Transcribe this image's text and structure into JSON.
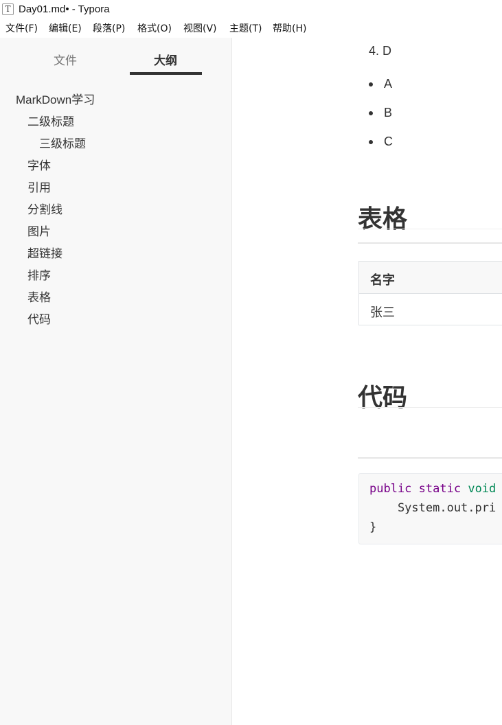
{
  "window": {
    "app_icon_letter": "T",
    "title": "Day01.md• - Typora"
  },
  "menu": [
    {
      "label": "文件(F)"
    },
    {
      "label": "编辑(E)"
    },
    {
      "label": "段落(P)"
    },
    {
      "label": "格式(O)"
    },
    {
      "label": "视图(V)"
    },
    {
      "label": "主题(T)"
    },
    {
      "label": "帮助(H)"
    }
  ],
  "sidebar": {
    "tabs": [
      {
        "label": "文件",
        "active": false
      },
      {
        "label": "大纲",
        "active": true
      }
    ],
    "outline": [
      {
        "label": "MarkDown学习",
        "level": 1
      },
      {
        "label": "二级标题",
        "level": 2
      },
      {
        "label": "三级标题",
        "level": 3
      },
      {
        "label": "字体",
        "level": 2
      },
      {
        "label": "引用",
        "level": 2
      },
      {
        "label": "分割线",
        "level": 2
      },
      {
        "label": "图片",
        "level": 2
      },
      {
        "label": "超链接",
        "level": 2
      },
      {
        "label": "排序",
        "level": 2
      },
      {
        "label": "表格",
        "level": 2
      },
      {
        "label": "代码",
        "level": 2
      }
    ]
  },
  "editor": {
    "ordered_item": "4. D",
    "bullets": [
      "A",
      "B",
      "C"
    ],
    "table_heading": "表格",
    "table": {
      "header": "名字",
      "cell": "张三"
    },
    "code_heading": "代码",
    "code": {
      "line1_kw1": "public",
      "line1_kw2": "static",
      "line1_kw3": "void",
      "line2": "    System.out.pri",
      "line3": "}"
    }
  },
  "colors": {
    "keyword": "#770088",
    "type_keyword": "#008855",
    "sidebar_bg": "#f8f8f8",
    "text": "#333333"
  }
}
